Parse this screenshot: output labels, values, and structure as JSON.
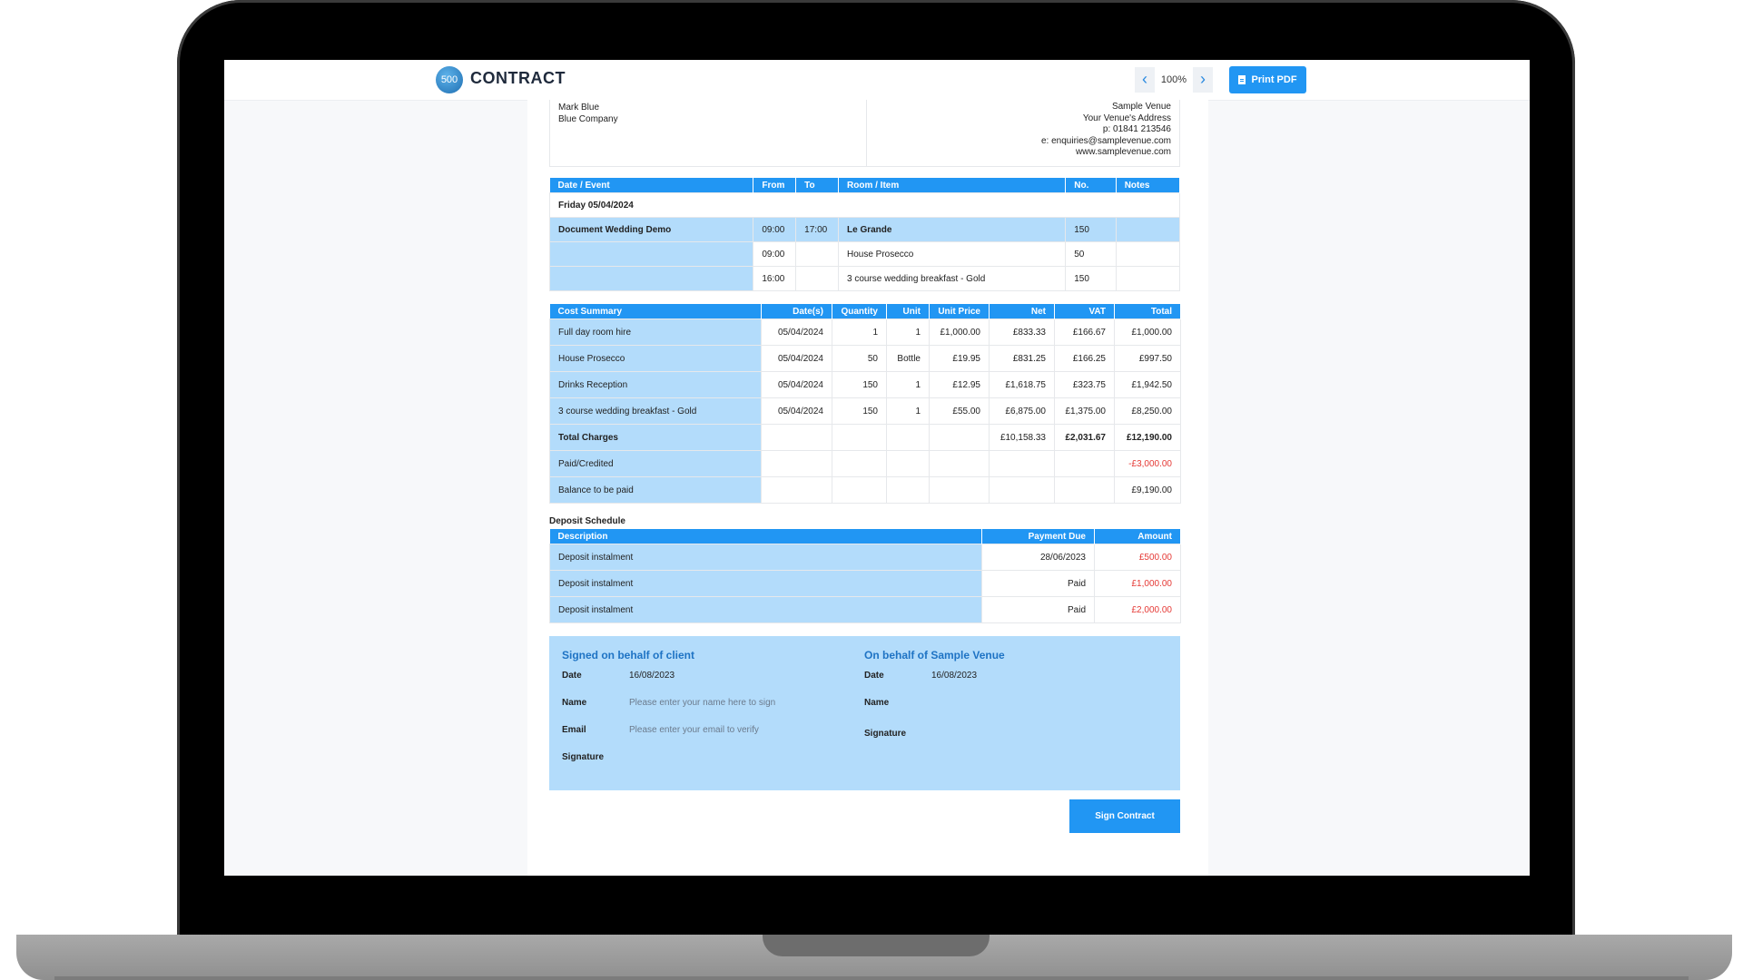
{
  "header": {
    "logo_badge": "500",
    "logo_text": "CONTRACT",
    "zoom": "100%",
    "print_label": "Print PDF",
    "prev_icon": "chevron-left-icon",
    "next_icon": "chevron-right-icon"
  },
  "colors": {
    "accent": "#2196f3",
    "light_blue": "#b3dcfb",
    "negative": "#e53935"
  },
  "client": {
    "name": "Mark Blue",
    "company": "Blue Company"
  },
  "venue": {
    "name": "Sample Venue",
    "address": "Your Venue's Address",
    "phone": "p: 01841 213546",
    "email": "e: enquiries@samplevenue.com",
    "website": "www.samplevenue.com"
  },
  "events": {
    "headers": [
      "Date / Event",
      "From",
      "To",
      "Room / Item",
      "No.",
      "Notes"
    ],
    "date_row": "Friday 05/04/2024",
    "rows": [
      {
        "event": "Document Wedding Demo",
        "from": "09:00",
        "to": "17:00",
        "item": "Le Grande",
        "no": "150",
        "notes": ""
      },
      {
        "event": "",
        "from": "09:00",
        "to": "",
        "item": "House Prosecco",
        "no": "50",
        "notes": ""
      },
      {
        "event": "",
        "from": "16:00",
        "to": "",
        "item": "3 course wedding breakfast - Gold",
        "no": "150",
        "notes": ""
      }
    ]
  },
  "costs": {
    "headers": [
      "Cost Summary",
      "Date(s)",
      "Quantity",
      "Unit",
      "Unit Price",
      "Net",
      "VAT",
      "Total"
    ],
    "rows": [
      {
        "item": "Full day room hire",
        "date": "05/04/2024",
        "qty": "1",
        "unit": "1",
        "price": "£1,000.00",
        "net": "£833.33",
        "vat": "£166.67",
        "total": "£1,000.00"
      },
      {
        "item": "House Prosecco",
        "date": "05/04/2024",
        "qty": "50",
        "unit": "Bottle",
        "price": "£19.95",
        "net": "£831.25",
        "vat": "£166.25",
        "total": "£997.50"
      },
      {
        "item": "Drinks Reception",
        "date": "05/04/2024",
        "qty": "150",
        "unit": "1",
        "price": "£12.95",
        "net": "£1,618.75",
        "vat": "£323.75",
        "total": "£1,942.50"
      },
      {
        "item": "3 course wedding breakfast - Gold",
        "date": "05/04/2024",
        "qty": "150",
        "unit": "1",
        "price": "£55.00",
        "net": "£6,875.00",
        "vat": "£1,375.00",
        "total": "£8,250.00"
      }
    ],
    "total_label": "Total Charges",
    "total_net": "£10,158.33",
    "total_vat": "£2,031.67",
    "total_total": "£12,190.00",
    "paid_label": "Paid/Credited",
    "paid_value": "-£3,000.00",
    "balance_label": "Balance to be paid",
    "balance_value": "£9,190.00"
  },
  "deposit": {
    "title": "Deposit Schedule",
    "headers": [
      "Description",
      "Payment Due",
      "Amount"
    ],
    "rows": [
      {
        "desc": "Deposit instalment",
        "due": "28/06/2023",
        "amount": "£500.00"
      },
      {
        "desc": "Deposit instalment",
        "due": "Paid",
        "amount": "£1,000.00"
      },
      {
        "desc": "Deposit instalment",
        "due": "Paid",
        "amount": "£2,000.00"
      }
    ]
  },
  "signing": {
    "client_heading": "Signed on behalf of client",
    "venue_heading": "On behalf of Sample Venue",
    "date_label": "Date",
    "name_label": "Name",
    "email_label": "Email",
    "signature_label": "Signature",
    "client_date": "16/08/2023",
    "venue_date": "16/08/2023",
    "name_placeholder": "Please enter your name here to sign",
    "email_placeholder": "Please enter your email to verify",
    "sign_button": "Sign Contract"
  }
}
